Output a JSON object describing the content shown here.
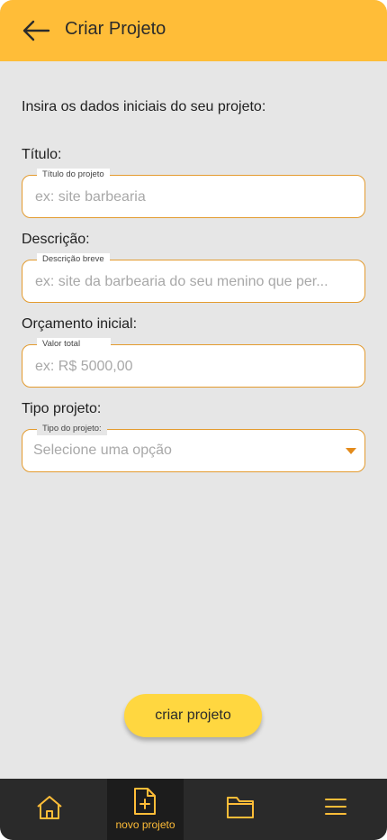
{
  "header": {
    "title": "Criar Projeto",
    "back_icon": "arrow-left-icon"
  },
  "intro": "Insira os dados iniciais do seu projeto:",
  "fields": {
    "titulo": {
      "label": "Título:",
      "legend": "Título do projeto",
      "placeholder": "ex: site barbearia"
    },
    "descricao": {
      "label": "Descrição:",
      "legend": "Descrição breve",
      "placeholder": "ex: site da barbearia do seu menino que per..."
    },
    "orcamento": {
      "label": "Orçamento inicial:",
      "legend": "Valor total",
      "placeholder": "ex: R$ 5000,00"
    },
    "tipo": {
      "label": "Tipo projeto:",
      "legend": "Tipo do projeto:",
      "value": "Selecione uma opção"
    }
  },
  "create_button": "criar projeto",
  "bottom_nav": {
    "items": [
      {
        "icon": "home-icon",
        "label": ""
      },
      {
        "icon": "new-file-icon",
        "label": "novo projeto"
      },
      {
        "icon": "folder-icon",
        "label": ""
      },
      {
        "icon": "menu-icon",
        "label": ""
      }
    ]
  },
  "colors": {
    "header": "#ffbd38",
    "accent": "#e39b2f",
    "button": "#ffd740",
    "nav_bg": "#2a2a2a",
    "background": "#e6e6e6"
  }
}
